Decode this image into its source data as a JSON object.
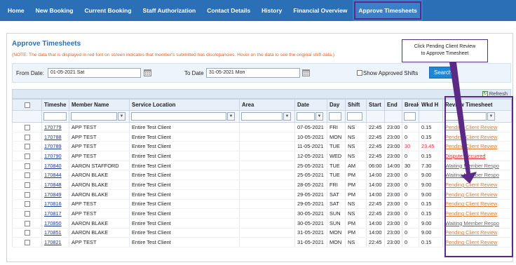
{
  "nav": [
    "Home",
    "New Booking",
    "Current Booking",
    "Staff Authorization",
    "Contact Details",
    "History",
    "Financial Overview",
    "Approve Timesheets"
  ],
  "panel": {
    "title": "Approve Timesheets",
    "note": "(NOTE: The data that is displayed in red font on screen indicates that member's submitted has discrepancies. Hover on the data to see the original shift data.)"
  },
  "filter": {
    "from_label": "From Date:",
    "from_value": "01-05-2021 Sat",
    "to_label": "To Date",
    "to_value": "31-05-2021 Mon",
    "show_approved_label": "Show Approved Shifts",
    "search_label": "Search"
  },
  "grid": {
    "refresh_label": "Refresh",
    "columns": [
      "Timeshe",
      "Member Name",
      "Service Location",
      "Area",
      "Date",
      "Day",
      "Shift",
      "Start",
      "End",
      "Break",
      "Wkd H",
      "Review Timesheet"
    ],
    "rows": [
      {
        "id": "170779",
        "member": "APP TEST",
        "location": "Entire Test Client",
        "area": "",
        "date": "07-05-2021",
        "day": "FRI",
        "shift": "NS",
        "start": "22:45",
        "end": "23:00",
        "brk": "0",
        "wkd": "0.15",
        "review": "Pending Client Review",
        "flag": "none"
      },
      {
        "id": "170788",
        "member": "APP TEST",
        "location": "Entire Test Client",
        "area": "",
        "date": "10-05-2021",
        "day": "MON",
        "shift": "NS",
        "start": "22:45",
        "end": "23:00",
        "brk": "0",
        "wkd": "0.15",
        "review": "Pending Client Review",
        "flag": "none"
      },
      {
        "id": "170789",
        "member": "APP TEST",
        "location": "Entire Test Client",
        "area": "",
        "date": "11-05-2021",
        "day": "TUE",
        "shift": "NS",
        "start": "22:45",
        "end": "23:00",
        "brk": "30",
        "wkd": "23.45",
        "review": "Pending Client Review",
        "flag": "red"
      },
      {
        "id": "170790",
        "member": "APP TEST",
        "location": "Entire Test Client",
        "area": "",
        "date": "12-05-2021",
        "day": "WED",
        "shift": "NS",
        "start": "22:45",
        "end": "23:00",
        "brk": "0",
        "wkd": "0.15",
        "review": "Dispute Occurred",
        "flag": "dispute"
      },
      {
        "id": "170840",
        "member": "AARON STAFFORD",
        "location": "Entire Test Client",
        "area": "",
        "date": "25-05-2021",
        "day": "TUE",
        "shift": "AM",
        "start": "06:00",
        "end": "14:00",
        "brk": "30",
        "wkd": "7.30",
        "review": "Waiting Member Respo",
        "flag": "grey"
      },
      {
        "id": "170844",
        "member": "AARON BLAKE",
        "location": "Entire Test Client",
        "area": "",
        "date": "25-05-2021",
        "day": "TUE",
        "shift": "PM",
        "start": "14:00",
        "end": "23:00",
        "brk": "0",
        "wkd": "9.00",
        "review": "Waiting Member Respo",
        "flag": "grey"
      },
      {
        "id": "170848",
        "member": "AARON BLAKE",
        "location": "Entire Test Client",
        "area": "",
        "date": "28-05-2021",
        "day": "FRI",
        "shift": "PM",
        "start": "14:00",
        "end": "23:00",
        "brk": "0",
        "wkd": "9.00",
        "review": "Pending Client Review",
        "flag": "none"
      },
      {
        "id": "170849",
        "member": "AARON BLAKE",
        "location": "Entire Test Client",
        "area": "",
        "date": "29-05-2021",
        "day": "SAT",
        "shift": "PM",
        "start": "14:00",
        "end": "23:00",
        "brk": "0",
        "wkd": "9.00",
        "review": "Pending Client Review",
        "flag": "none"
      },
      {
        "id": "170816",
        "member": "APP TEST",
        "location": "Entire Test Client",
        "area": "",
        "date": "29-05-2021",
        "day": "SAT",
        "shift": "NS",
        "start": "22:45",
        "end": "23:00",
        "brk": "0",
        "wkd": "0.15",
        "review": "Pending Client Review",
        "flag": "none"
      },
      {
        "id": "170817",
        "member": "APP TEST",
        "location": "Entire Test Client",
        "area": "",
        "date": "30-05-2021",
        "day": "SUN",
        "shift": "NS",
        "start": "22:45",
        "end": "23:00",
        "brk": "0",
        "wkd": "0.15",
        "review": "Pending Client Review",
        "flag": "none"
      },
      {
        "id": "170850",
        "member": "AARON BLAKE",
        "location": "Entire Test Client",
        "area": "",
        "date": "30-05-2021",
        "day": "SUN",
        "shift": "PM",
        "start": "14:00",
        "end": "23:00",
        "brk": "0",
        "wkd": "9.00",
        "review": "Waiting Member Respo",
        "flag": "grey"
      },
      {
        "id": "170851",
        "member": "AARON BLAKE",
        "location": "Entire Test Client",
        "area": "",
        "date": "31-05-2021",
        "day": "MON",
        "shift": "PM",
        "start": "14:00",
        "end": "23:00",
        "brk": "0",
        "wkd": "9.00",
        "review": "Pending Client Review",
        "flag": "none"
      },
      {
        "id": "170821",
        "member": "APP TEST",
        "location": "Entire Test Client",
        "area": "",
        "date": "31-05-2021",
        "day": "MON",
        "shift": "NS",
        "start": "22:45",
        "end": "23:00",
        "brk": "0",
        "wkd": "0.15",
        "review": "Pending Client Review",
        "flag": "none"
      }
    ]
  },
  "annotation": {
    "callout_line1": "Click Pending Client Review",
    "callout_line2": "to Approve Timesheet"
  },
  "colors": {
    "nav_bg": "#2b6fb6",
    "annotation": "#5a2a86",
    "discrepancy_red": "#e53030",
    "review_link_orange": "#e07a2e"
  }
}
